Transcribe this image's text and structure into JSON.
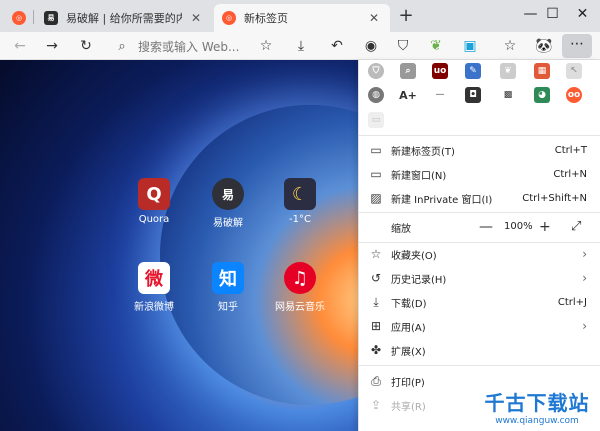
{
  "tabs": [
    {
      "label": "",
      "favicon": "edge-logo-icon",
      "color": "#ff5b33"
    },
    {
      "label": "易破解 | 给你所需要的内容YPOJIE",
      "favicon": "易",
      "color": "#2c2c2c"
    },
    {
      "label": "新标签页",
      "favicon": "edge-logo-icon",
      "color": "#ff5b33"
    }
  ],
  "window_controls": {
    "minimize": "—",
    "maximize": "☐",
    "close": "✕"
  },
  "toolbar": {
    "search_placeholder": "搜索或输入 Web..."
  },
  "speed_dial": [
    {
      "label": "Quora",
      "glyph": "Q",
      "color": "#b92b27"
    },
    {
      "label": "易破解",
      "glyph": "易",
      "color": "#2f3038"
    },
    {
      "label": "-1°C",
      "glyph": "☾",
      "color": "#2b2d42"
    },
    {
      "label": "新浪微博",
      "glyph": "微",
      "color": "#ffffff"
    },
    {
      "label": "知乎",
      "glyph": "知",
      "color": "#0a84ff"
    },
    {
      "label": "网易云音乐",
      "glyph": "♫",
      "color": "#e60026"
    }
  ],
  "menu": {
    "new_tab": {
      "label": "新建标签页(T)",
      "shortcut": "Ctrl+T"
    },
    "new_window": {
      "label": "新建窗口(N)",
      "shortcut": "Ctrl+N"
    },
    "new_inprivate": {
      "label": "新建 InPrivate 窗口(I)",
      "shortcut": "Ctrl+Shift+N"
    },
    "zoom": {
      "label": "缩放",
      "value": "100%"
    },
    "favorites": {
      "label": "收藏夹(O)"
    },
    "history": {
      "label": "历史记录(H)"
    },
    "downloads": {
      "label": "下载(D)",
      "shortcut": "Ctrl+J"
    },
    "apps": {
      "label": "应用(A)"
    },
    "extensions": {
      "label": "扩展(X)"
    },
    "print": {
      "label": "打印(P)"
    },
    "share": {
      "label": "共享(R)"
    }
  },
  "watermark": {
    "line1": "千古下载站",
    "line2": "www.qianguw.com"
  }
}
